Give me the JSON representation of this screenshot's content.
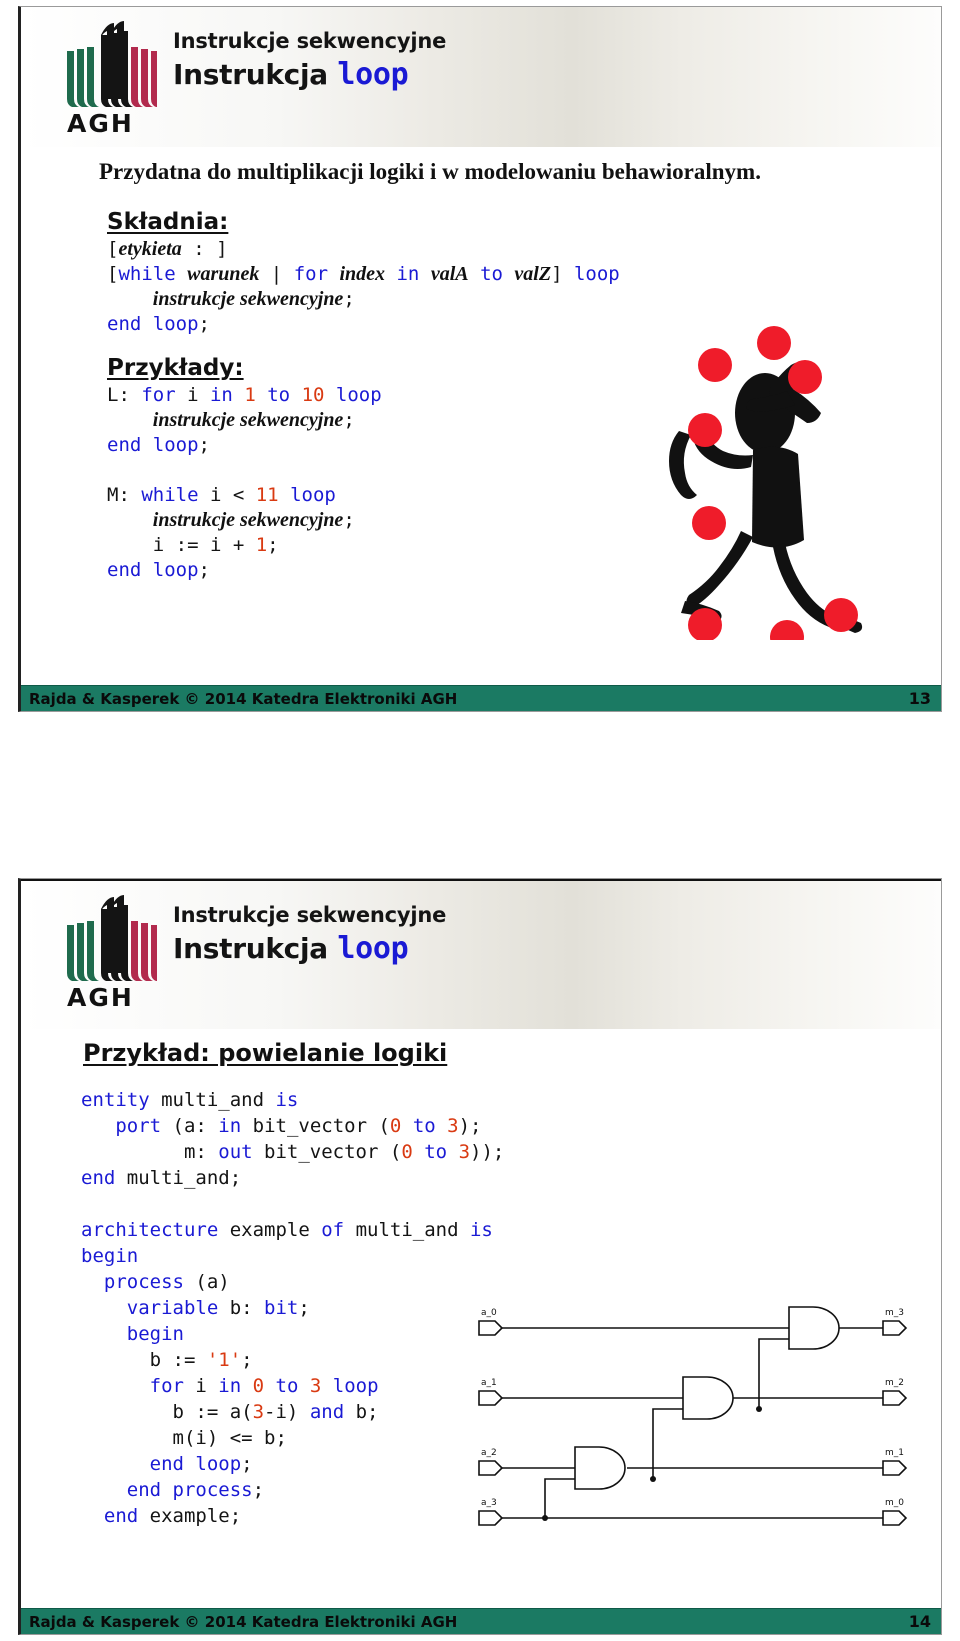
{
  "brand": {
    "logo_text": "AGH",
    "accent_blue": "#1a1ad4",
    "accent_red": "#d93a12",
    "footer_green": "#1b7a63",
    "logo_green": "#1f6b4d",
    "logo_black": "#141414",
    "logo_crimson": "#b22a4d"
  },
  "slide13": {
    "header": {
      "subtitle": "Instrukcje sekwencyjne",
      "title_prefix": "Instrukcja",
      "title_keyword": "loop"
    },
    "lead": "Przydatna do multiplikacji logiki i w modelowaniu behawioralnym.",
    "syntax": {
      "heading": "Składnia:",
      "lines": [
        {
          "segments": [
            {
              "t": "[",
              "c": "plain"
            },
            {
              "t": "etykieta",
              "c": "italic"
            },
            {
              "t": " : ]",
              "c": "plain"
            }
          ]
        },
        {
          "segments": [
            {
              "t": "[",
              "c": "plain"
            },
            {
              "t": "while",
              "c": "kw"
            },
            {
              "t": " ",
              "c": "plain"
            },
            {
              "t": "warunek",
              "c": "italic"
            },
            {
              "t": " | ",
              "c": "plain"
            },
            {
              "t": "for",
              "c": "kw"
            },
            {
              "t": " ",
              "c": "plain"
            },
            {
              "t": "index",
              "c": "italic"
            },
            {
              "t": " ",
              "c": "plain"
            },
            {
              "t": "in",
              "c": "kw"
            },
            {
              "t": " ",
              "c": "plain"
            },
            {
              "t": "valA",
              "c": "italic"
            },
            {
              "t": " ",
              "c": "plain"
            },
            {
              "t": "to",
              "c": "kw"
            },
            {
              "t": " ",
              "c": "plain"
            },
            {
              "t": "valZ",
              "c": "italic"
            },
            {
              "t": "] ",
              "c": "plain"
            },
            {
              "t": "loop",
              "c": "kw"
            }
          ]
        },
        {
          "segments": [
            {
              "t": "    ",
              "c": "plain"
            },
            {
              "t": "instrukcje sekwencyjne",
              "c": "italic"
            },
            {
              "t": ";",
              "c": "plain"
            }
          ]
        },
        {
          "segments": [
            {
              "t": "end loop",
              "c": "kw"
            },
            {
              "t": ";",
              "c": "plain"
            }
          ]
        }
      ]
    },
    "examples": {
      "heading": "Przykłady:",
      "lines": [
        {
          "segments": [
            {
              "t": "L: ",
              "c": "plain"
            },
            {
              "t": "for",
              "c": "kw"
            },
            {
              "t": " i ",
              "c": "plain"
            },
            {
              "t": "in",
              "c": "kw"
            },
            {
              "t": " ",
              "c": "plain"
            },
            {
              "t": "1",
              "c": "num"
            },
            {
              "t": " ",
              "c": "plain"
            },
            {
              "t": "to",
              "c": "kw"
            },
            {
              "t": " ",
              "c": "plain"
            },
            {
              "t": "10",
              "c": "num"
            },
            {
              "t": " ",
              "c": "plain"
            },
            {
              "t": "loop",
              "c": "kw"
            }
          ]
        },
        {
          "segments": [
            {
              "t": "    ",
              "c": "plain"
            },
            {
              "t": "instrukcje sekwencyjne",
              "c": "italic"
            },
            {
              "t": ";",
              "c": "plain"
            }
          ]
        },
        {
          "segments": [
            {
              "t": "end loop",
              "c": "kw"
            },
            {
              "t": ";",
              "c": "plain"
            }
          ]
        },
        {
          "segments": [
            {
              "t": " ",
              "c": "plain"
            }
          ]
        },
        {
          "segments": [
            {
              "t": "M: ",
              "c": "plain"
            },
            {
              "t": "while",
              "c": "kw"
            },
            {
              "t": " i < ",
              "c": "plain"
            },
            {
              "t": "11",
              "c": "num"
            },
            {
              "t": " ",
              "c": "plain"
            },
            {
              "t": "loop",
              "c": "kw"
            }
          ]
        },
        {
          "segments": [
            {
              "t": "    ",
              "c": "plain"
            },
            {
              "t": "instrukcje sekwencyjne",
              "c": "italic"
            },
            {
              "t": ";",
              "c": "plain"
            }
          ]
        },
        {
          "segments": [
            {
              "t": "    i := i + ",
              "c": "plain"
            },
            {
              "t": "1",
              "c": "num"
            },
            {
              "t": ";",
              "c": "plain"
            }
          ]
        },
        {
          "segments": [
            {
              "t": "end loop",
              "c": "kw"
            },
            {
              "t": ";",
              "c": "plain"
            }
          ]
        }
      ]
    },
    "illustration": "juggler-with-red-balls",
    "footer": {
      "text": "Rajda & Kasperek © 2014 Katedra Elektroniki AGH",
      "page": "13"
    }
  },
  "slide14": {
    "header": {
      "subtitle": "Instrukcje sekwencyjne",
      "title_prefix": "Instrukcja",
      "title_keyword": "loop"
    },
    "heading": "Przykład: powielanie logiki",
    "code_lines": [
      {
        "segments": [
          {
            "t": "entity",
            "c": "kw"
          },
          {
            "t": " multi_and ",
            "c": "plain"
          },
          {
            "t": "is",
            "c": "kw"
          }
        ]
      },
      {
        "segments": [
          {
            "t": "   ",
            "c": "plain"
          },
          {
            "t": "port",
            "c": "kw"
          },
          {
            "t": " (a: ",
            "c": "plain"
          },
          {
            "t": "in",
            "c": "kw"
          },
          {
            "t": " bit_vector (",
            "c": "plain"
          },
          {
            "t": "0",
            "c": "num"
          },
          {
            "t": " ",
            "c": "plain"
          },
          {
            "t": "to",
            "c": "kw"
          },
          {
            "t": " ",
            "c": "plain"
          },
          {
            "t": "3",
            "c": "num"
          },
          {
            "t": ");",
            "c": "plain"
          }
        ]
      },
      {
        "segments": [
          {
            "t": "         m: ",
            "c": "plain"
          },
          {
            "t": "out",
            "c": "kw"
          },
          {
            "t": " bit_vector (",
            "c": "plain"
          },
          {
            "t": "0",
            "c": "num"
          },
          {
            "t": " ",
            "c": "plain"
          },
          {
            "t": "to",
            "c": "kw"
          },
          {
            "t": " ",
            "c": "plain"
          },
          {
            "t": "3",
            "c": "num"
          },
          {
            "t": "));",
            "c": "plain"
          }
        ]
      },
      {
        "segments": [
          {
            "t": "end",
            "c": "kw"
          },
          {
            "t": " multi_and;",
            "c": "plain"
          }
        ]
      },
      {
        "segments": [
          {
            "t": " ",
            "c": "plain"
          }
        ]
      },
      {
        "segments": [
          {
            "t": "architecture",
            "c": "kw"
          },
          {
            "t": " example ",
            "c": "plain"
          },
          {
            "t": "of",
            "c": "kw"
          },
          {
            "t": " multi_and ",
            "c": "plain"
          },
          {
            "t": "is",
            "c": "kw"
          }
        ]
      },
      {
        "segments": [
          {
            "t": "begin",
            "c": "kw"
          }
        ]
      },
      {
        "segments": [
          {
            "t": "  ",
            "c": "plain"
          },
          {
            "t": "process",
            "c": "kw"
          },
          {
            "t": " (a)",
            "c": "plain"
          }
        ]
      },
      {
        "segments": [
          {
            "t": "    ",
            "c": "plain"
          },
          {
            "t": "variable",
            "c": "kw"
          },
          {
            "t": " b: ",
            "c": "plain"
          },
          {
            "t": "bit",
            "c": "kw"
          },
          {
            "t": ";",
            "c": "plain"
          }
        ]
      },
      {
        "segments": [
          {
            "t": "    ",
            "c": "plain"
          },
          {
            "t": "begin",
            "c": "kw"
          }
        ]
      },
      {
        "segments": [
          {
            "t": "      b := ",
            "c": "plain"
          },
          {
            "t": "'1'",
            "c": "num"
          },
          {
            "t": ";",
            "c": "plain"
          }
        ]
      },
      {
        "segments": [
          {
            "t": "      ",
            "c": "plain"
          },
          {
            "t": "for",
            "c": "kw"
          },
          {
            "t": " i ",
            "c": "plain"
          },
          {
            "t": "in",
            "c": "kw"
          },
          {
            "t": " ",
            "c": "plain"
          },
          {
            "t": "0",
            "c": "num"
          },
          {
            "t": " ",
            "c": "plain"
          },
          {
            "t": "to",
            "c": "kw"
          },
          {
            "t": " ",
            "c": "plain"
          },
          {
            "t": "3",
            "c": "num"
          },
          {
            "t": " ",
            "c": "plain"
          },
          {
            "t": "loop",
            "c": "kw"
          }
        ]
      },
      {
        "segments": [
          {
            "t": "        b := a(",
            "c": "plain"
          },
          {
            "t": "3",
            "c": "num"
          },
          {
            "t": "-i) ",
            "c": "plain"
          },
          {
            "t": "and",
            "c": "kw"
          },
          {
            "t": " b;",
            "c": "plain"
          }
        ]
      },
      {
        "segments": [
          {
            "t": "        m(i) <= b;",
            "c": "plain"
          }
        ]
      },
      {
        "segments": [
          {
            "t": "      ",
            "c": "plain"
          },
          {
            "t": "end loop",
            "c": "kw"
          },
          {
            "t": ";",
            "c": "plain"
          }
        ]
      },
      {
        "segments": [
          {
            "t": "    ",
            "c": "plain"
          },
          {
            "t": "end process",
            "c": "kw"
          },
          {
            "t": ";",
            "c": "plain"
          }
        ]
      },
      {
        "segments": [
          {
            "t": "  ",
            "c": "plain"
          },
          {
            "t": "end",
            "c": "kw"
          },
          {
            "t": " example;",
            "c": "plain"
          }
        ]
      }
    ],
    "circuit": {
      "title": "multi_and-schematic",
      "inputs": [
        "a_0",
        "a_1",
        "a_2",
        "a_3"
      ],
      "outputs": [
        "m_3",
        "m_2",
        "m_1",
        "m_0"
      ],
      "gates": [
        "AND",
        "AND",
        "AND"
      ]
    },
    "footer": {
      "text": "Rajda & Kasperek © 2014 Katedra Elektroniki AGH",
      "page": "14"
    }
  }
}
